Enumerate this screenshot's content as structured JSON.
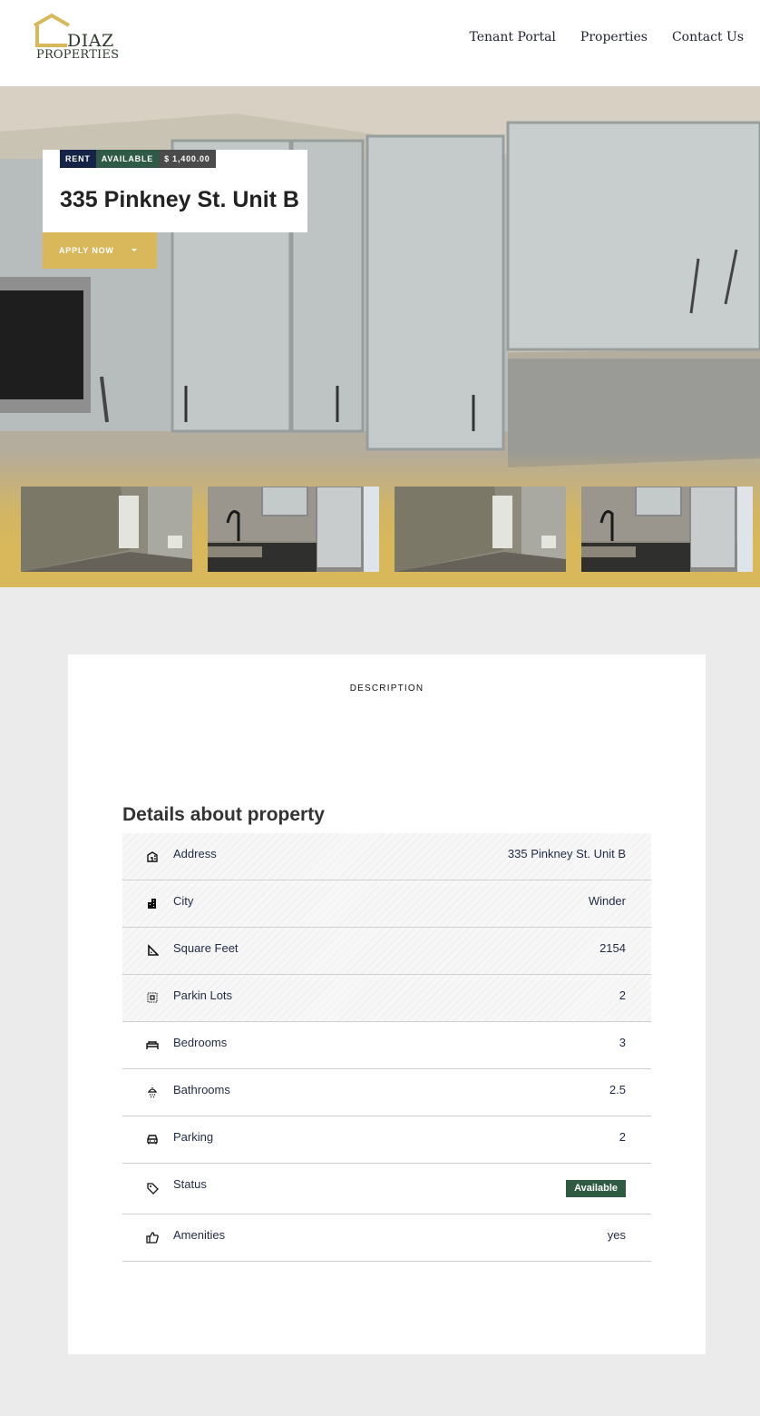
{
  "header": {
    "logo_line1": "DIAZ",
    "logo_line2": "PROPERTIES",
    "nav": [
      "Tenant Portal",
      "Properties",
      "Contact Us"
    ]
  },
  "hero": {
    "badges": {
      "rent": "RENT",
      "available": "AVAILABLE",
      "price": "$ 1,400.00"
    },
    "title": "335 Pinkney St. Unit B",
    "apply_button": "APPLY NOW"
  },
  "content": {
    "description_heading": "DESCRIPTION",
    "details_heading": "Details about property",
    "details": [
      {
        "label": "Address",
        "value": "335 Pinkney St. Unit B",
        "icon": "building-icon"
      },
      {
        "label": "City",
        "value": "Winder",
        "icon": "city-icon"
      },
      {
        "label": "Square Feet",
        "value": "2154",
        "icon": "ruler-icon"
      },
      {
        "label": "Parkin Lots",
        "value": "2",
        "icon": "parking-lot-icon"
      },
      {
        "label": "Bedrooms",
        "value": "3",
        "icon": "bed-icon"
      },
      {
        "label": "Bathrooms",
        "value": "2.5",
        "icon": "shower-icon"
      },
      {
        "label": "Parking",
        "value": "2",
        "icon": "car-icon"
      },
      {
        "label": "Status",
        "value": "Available",
        "icon": "tag-icon"
      },
      {
        "label": "Amenities",
        "value": "yes",
        "icon": "thumbs-up-icon"
      }
    ]
  },
  "colors": {
    "gold": "#d9b85b",
    "navy": "#142346",
    "green": "#2f5a45"
  }
}
